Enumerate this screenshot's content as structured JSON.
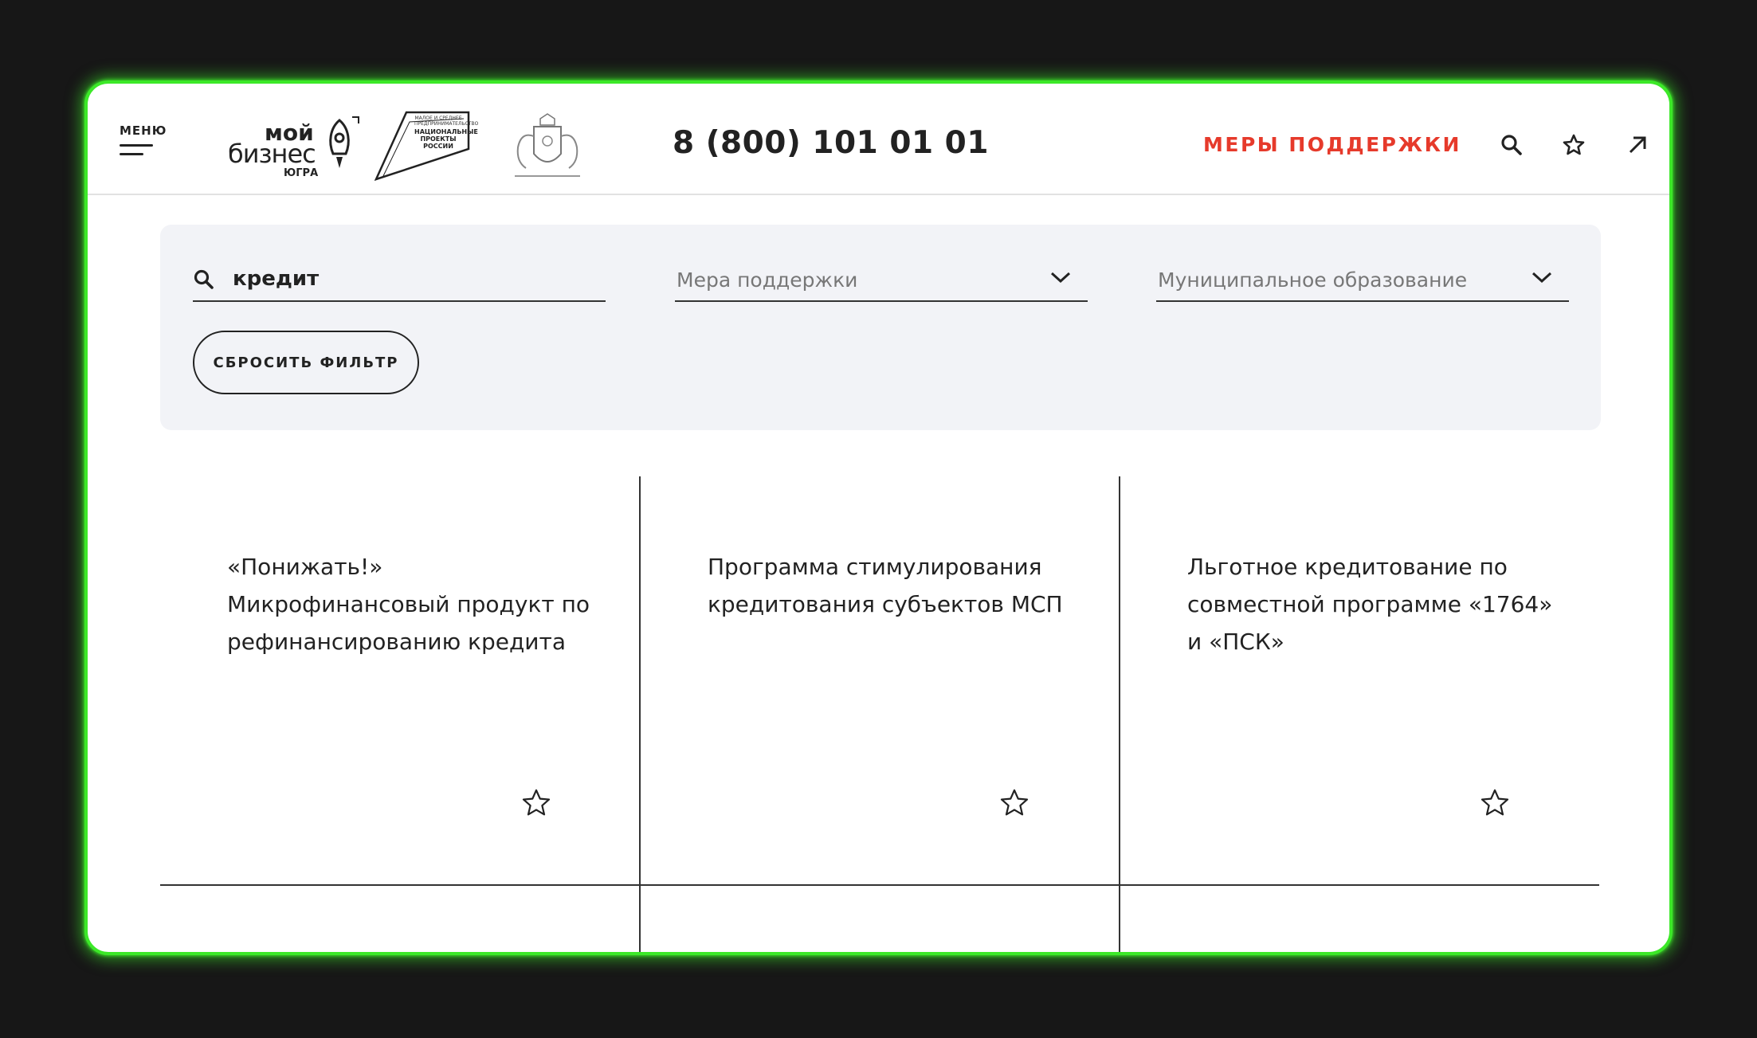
{
  "header": {
    "menu_label": "МЕНЮ",
    "logo_brand": {
      "line1": "мой",
      "line2": "бизнес",
      "line3": "ЮГРА"
    },
    "logo_np": {
      "line1": "МАЛОЕ И СРЕДНЕЕ ПРЕДПРИНИМАТЕЛЬСТВО",
      "line2": "НАЦИОНАЛЬНЫЕ ПРОЕКТЫ РОССИИ"
    },
    "phone": "8 (800) 101 01 01",
    "support_link": "МЕРЫ ПОДДЕРЖКИ",
    "icons": [
      "search-icon",
      "star-icon",
      "arrow-up-right-icon"
    ]
  },
  "filters": {
    "search_value": "кредит",
    "support_measure_placeholder": "Мера поддержки",
    "municipality_placeholder": "Муниципальное образование",
    "reset_label": "СБРОСИТЬ ФИЛЬТР"
  },
  "cards": [
    {
      "title": "«Понижать!» Микрофинансовый продукт по рефинансированию кредита"
    },
    {
      "title": "Программа стимулирования кредитования субъектов МСП"
    },
    {
      "title": "Льготное кредитование по совместной программе «1764» и «ПСК»"
    }
  ],
  "colors": {
    "accent": "#e63a2b",
    "frame": "#3ce828",
    "panel": "#f2f3f7",
    "background": "#171717"
  }
}
